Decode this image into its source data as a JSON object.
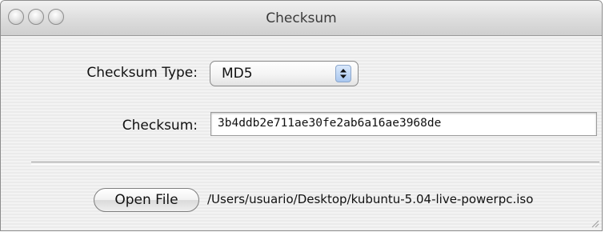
{
  "window": {
    "title": "Checksum"
  },
  "form": {
    "type_label": "Checksum Type:",
    "type_value": "MD5",
    "checksum_label": "Checksum:",
    "checksum_value": "3b4ddb2e711ae30fe2ab6a16ae3968de"
  },
  "actions": {
    "open_label": "Open File",
    "file_path": "/Users/usuario/Desktop/kubuntu-5.04-live-powerpc.iso"
  },
  "icons": {
    "close": "close-button-icon",
    "minimize": "minimize-button-icon",
    "zoom": "zoom-button-icon",
    "popup_arrows": "up-down-arrows-icon",
    "resize": "resize-grip-icon"
  }
}
